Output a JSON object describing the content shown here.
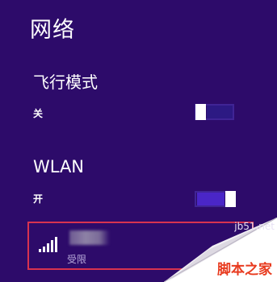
{
  "panel": {
    "title": "网络"
  },
  "airplane_mode": {
    "title": "飞行模式",
    "state_label": "关",
    "enabled": false
  },
  "wlan": {
    "title": "WLAN",
    "state_label": "开",
    "enabled": true
  },
  "network": {
    "status": "受限",
    "signal_icon": "wifi-signal-bars-icon",
    "highlight_color": "#d8334f"
  },
  "watermark": {
    "site": "jb51.net",
    "brand": "脚本之家"
  },
  "colors": {
    "background": "#2d0b6a",
    "toggle_on": "#4a26c7",
    "toggle_off": "#2c1983"
  }
}
